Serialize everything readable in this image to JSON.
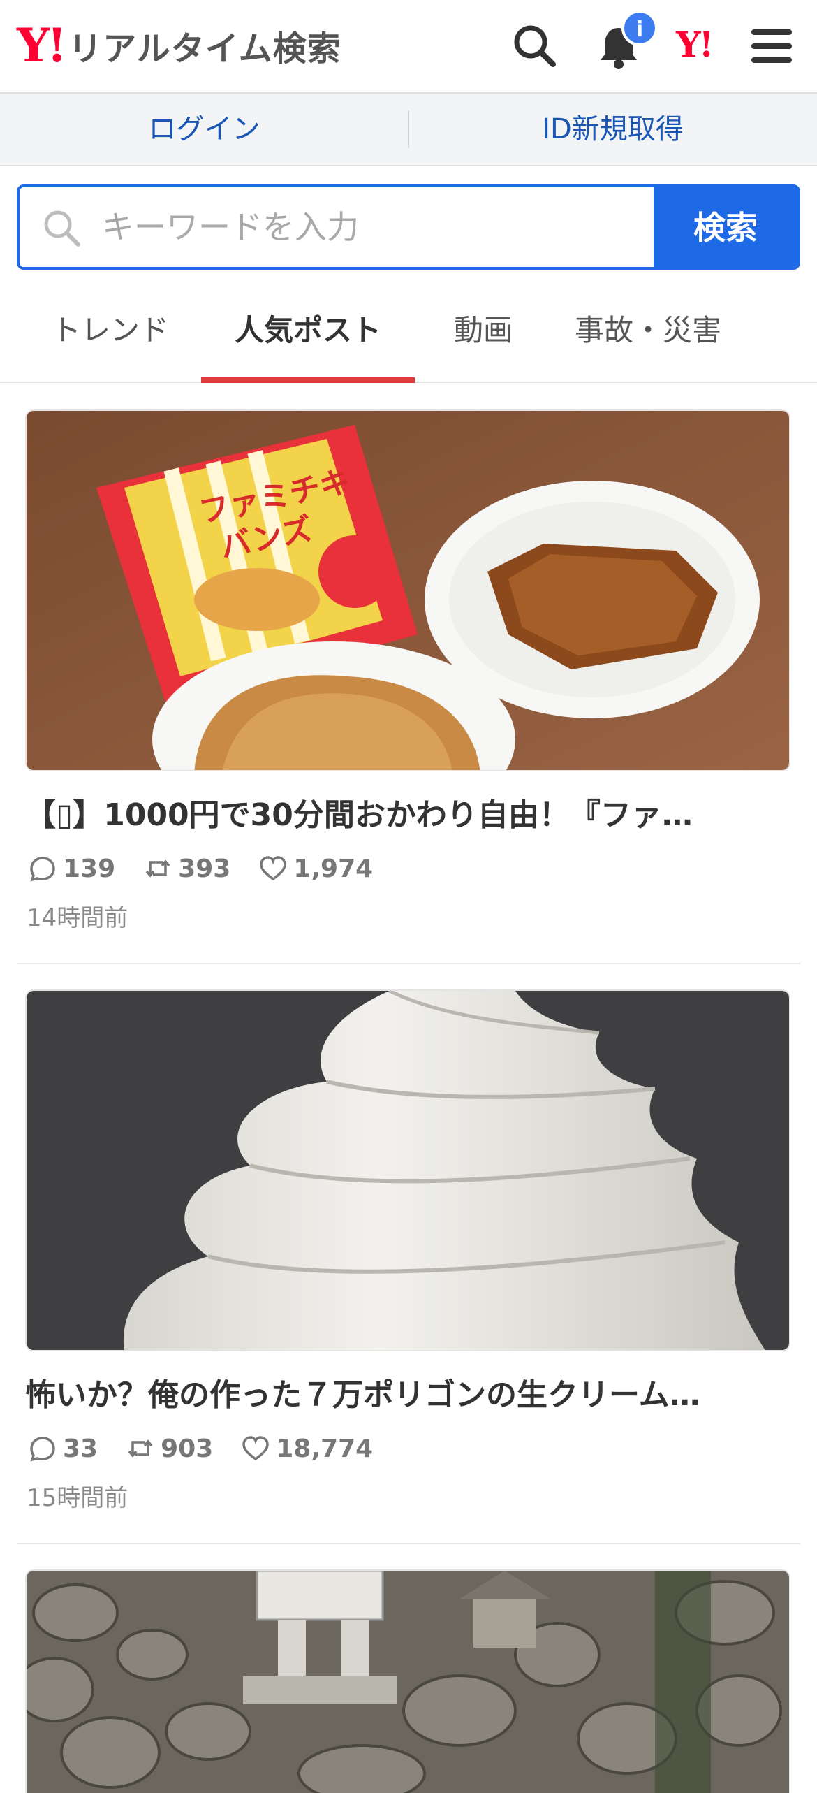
{
  "header": {
    "logo_mark": "Y!",
    "logo_text": "リアルタイム検索",
    "notification_badge": "i",
    "yahoo_mark": "Y!"
  },
  "login_bar": {
    "login_label": "ログイン",
    "signup_label": "ID新規取得"
  },
  "search": {
    "placeholder": "キーワードを入力",
    "button_label": "検索"
  },
  "tabs": [
    {
      "label": "トレンド",
      "active": false
    },
    {
      "label": "人気ポスト",
      "active": true
    },
    {
      "label": "動画",
      "active": false
    },
    {
      "label": "事故・災害",
      "active": false
    }
  ],
  "posts": [
    {
      "title": "【▯】1000円で30分間おかわり自由！『ファ…",
      "replies": "139",
      "reposts": "393",
      "likes": "1,974",
      "time": "14時間前",
      "image": "fried chicken cutlets on paper plates with Famichiki buns package",
      "image_package_text": "ファミチキ\nバンズ"
    },
    {
      "title": "怖いか？俺の作った７万ポリゴンの生クリーム…",
      "replies": "33",
      "reposts": "903",
      "likes": "18,774",
      "time": "15時間前",
      "image": "3D rendered white whipped cream swirl on dark gray background"
    },
    {
      "image": "stone wall with small shrine and air conditioner unit"
    }
  ],
  "colors": {
    "brand_red": "#ff0033",
    "accent_blue": "#1e6ae6",
    "tab_indicator": "#e03b3b",
    "link_blue": "#1a56b4"
  }
}
